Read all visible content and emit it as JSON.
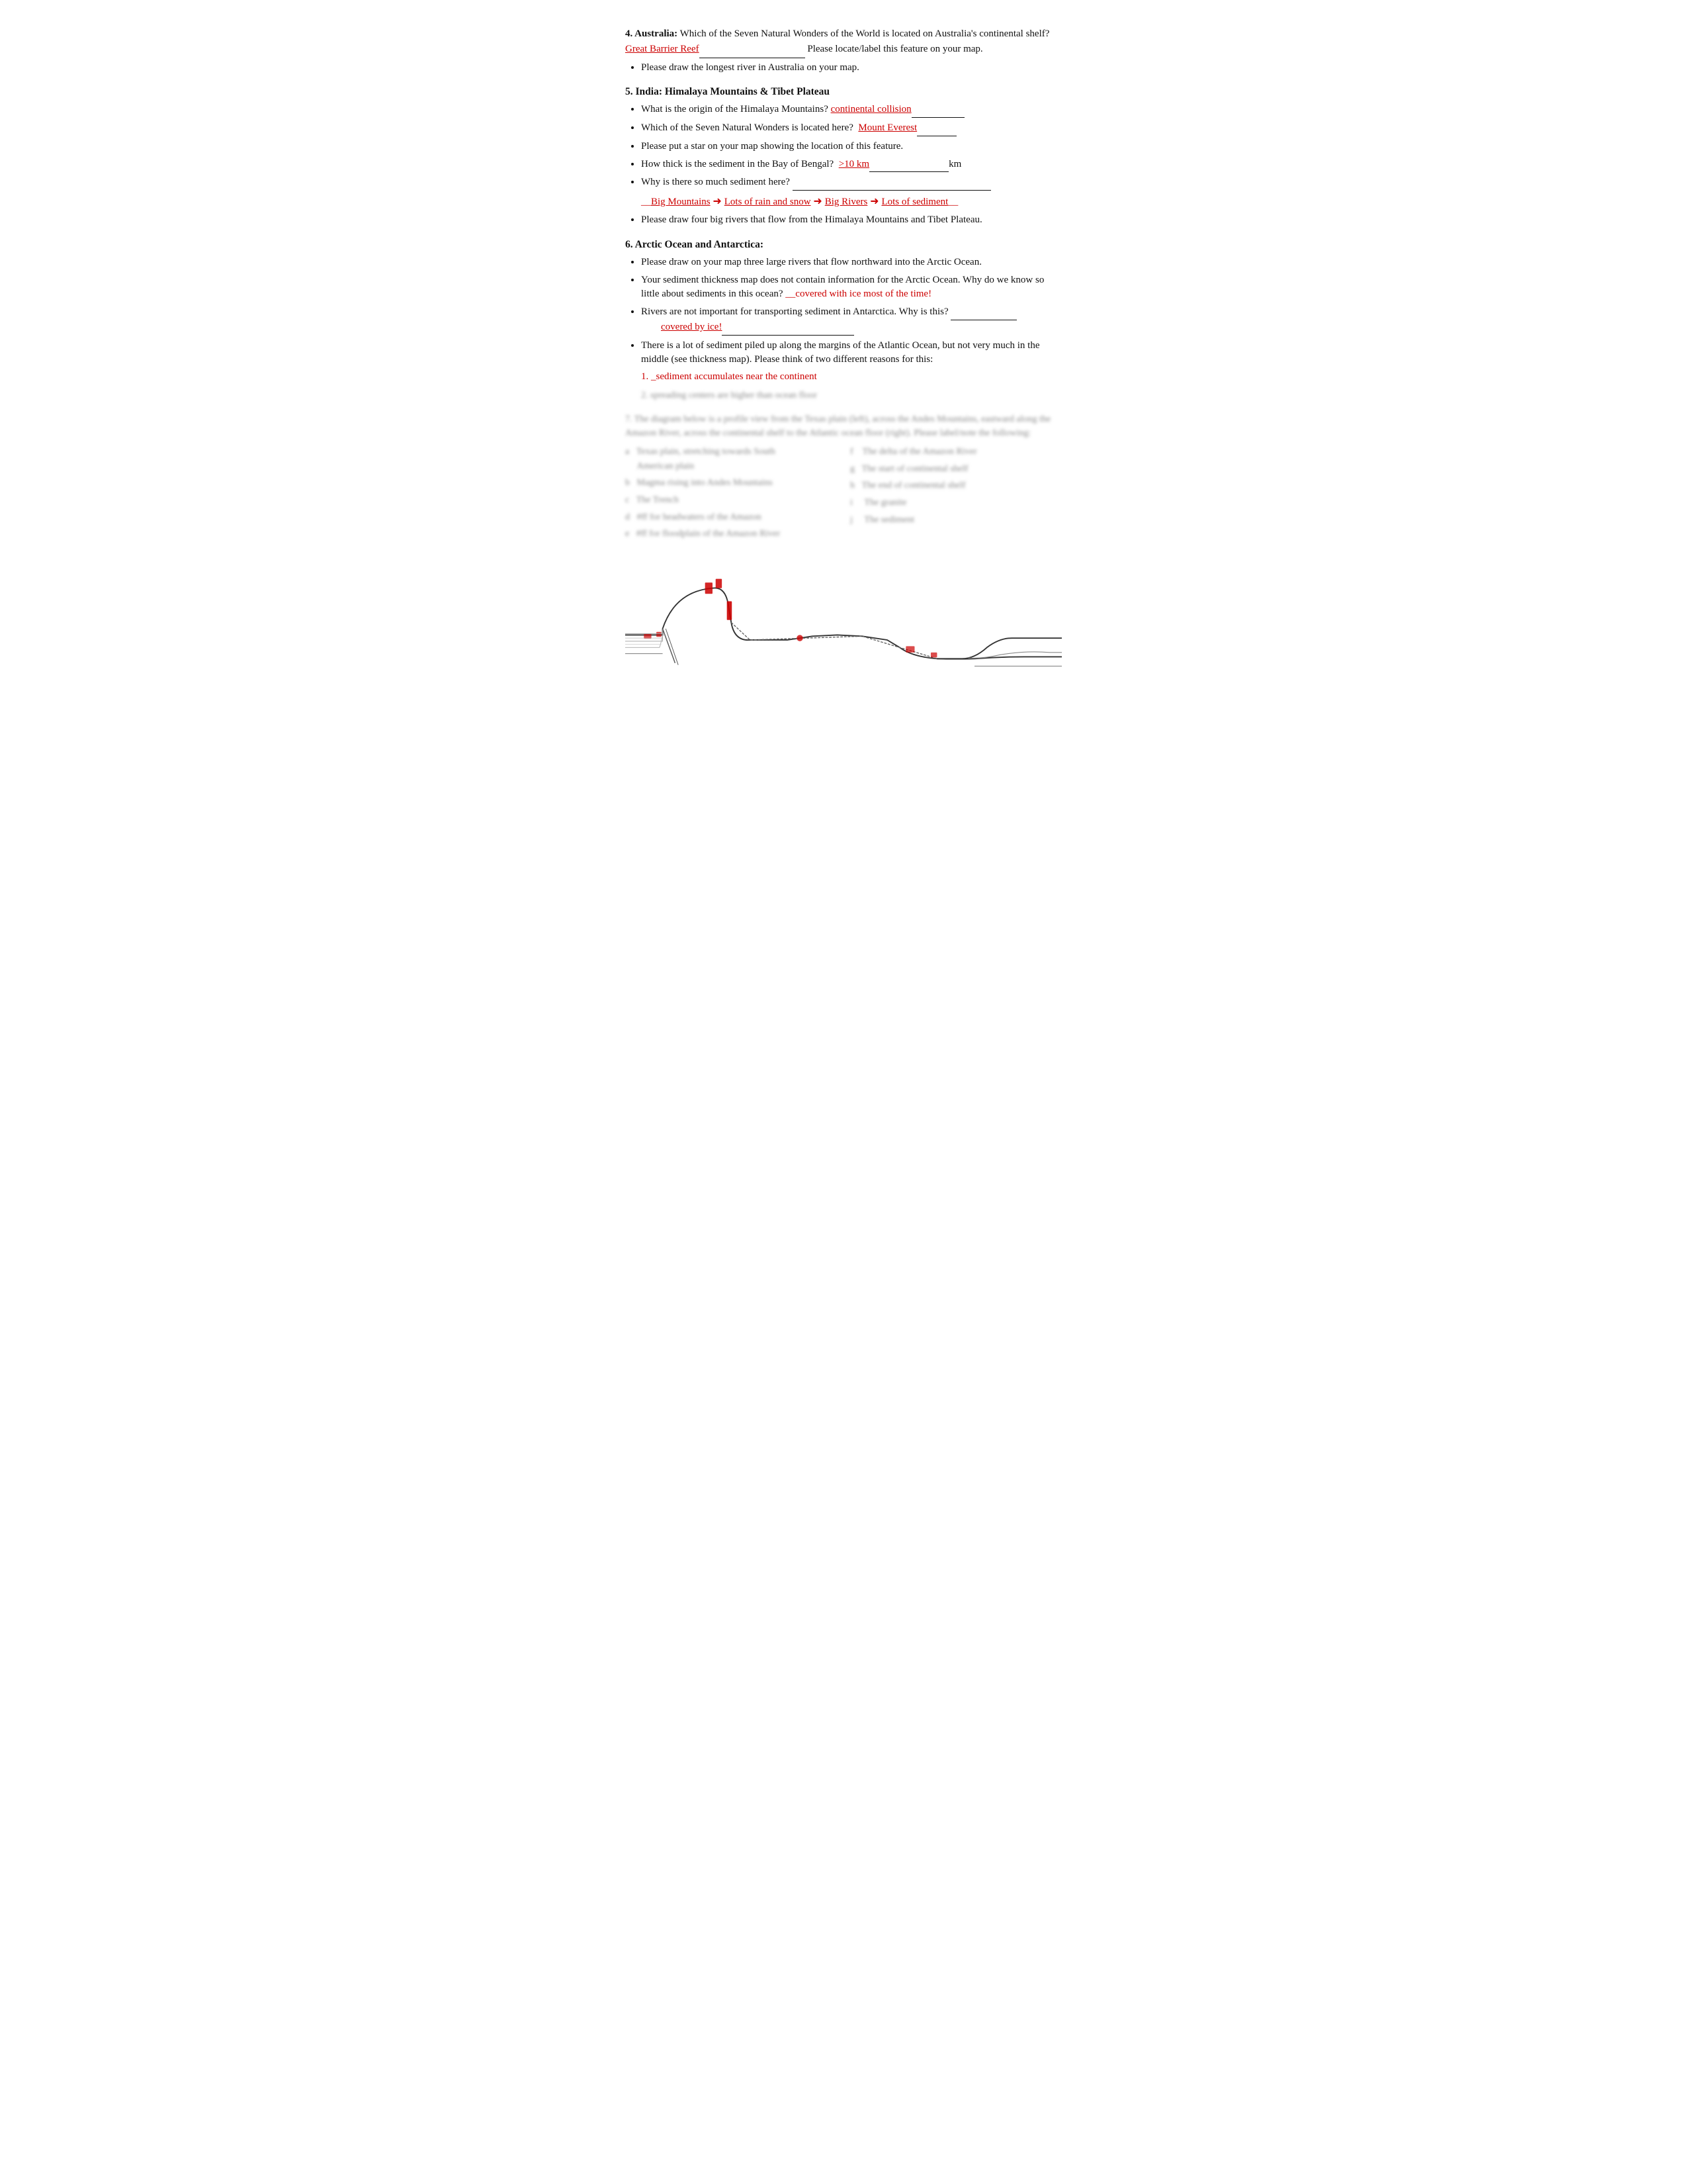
{
  "sections": {
    "s4": {
      "label": "4. Australia:",
      "question": " Which of the Seven Natural Wonders of the World is located on Australia's continental shelf?",
      "answer": "Great Barrier Reef",
      "after_answer": " Please locate/label this feature on your map.",
      "bullets": [
        "Please draw the longest river in Australia on your map."
      ]
    },
    "s5": {
      "label": "5. India:  Himalaya Mountains & Tibet Plateau",
      "bullets": [
        {
          "text": "What is the origin of the Himalaya Mountains? ",
          "answer": "continental collision",
          "blank_after": true,
          "blank_width": 80
        },
        {
          "text": "Which of the Seven Natural Wonders is located here?  ",
          "answer": "Mount Everest",
          "blank_after": true,
          "blank_width": 60
        },
        {
          "text": "Please put a star on your map showing the location of this feature.",
          "answer": "",
          "blank_after": false
        },
        {
          "text": "How thick is the sediment in the Bay of Bengal?  ",
          "answer": ">10 km",
          "blank_after": true,
          "blank_width": 140,
          "suffix": "km"
        },
        {
          "text": "Why is there so much sediment here?  ",
          "answer": "",
          "blank_after": false,
          "has_long_blank": true
        }
      ],
      "chain": {
        "parts": [
          "Big Mountains",
          "Lots of rain and snow",
          "Big Rivers",
          "Lots of sediment"
        ],
        "prefix": "__",
        "suffix": "__"
      },
      "last_bullet": "Please draw four big rivers that flow from the Himalaya Mountains and Tibet Plateau."
    },
    "s6": {
      "label": "6. Arctic Ocean and Antarctica:",
      "bullets": [
        {
          "text": "Please draw on your map three large rivers that flow northward into the Arctic Ocean.",
          "answer": ""
        },
        {
          "text": "Your sediment thickness map does not contain information for the Arctic Ocean.  Why do we know so little about sediments in this ocean?  ",
          "answer": "covered with ice most of the time!",
          "blank_prefix": "__"
        },
        {
          "text": "Rivers are not important for transporting sediment in Antarctica.  Why is this?  ",
          "answer": "covered by ice!",
          "blank_suffix_line": true
        },
        {
          "text": "There is a lot of sediment piled up along the margins of the Atlantic Ocean, but not very much in the middle (see thickness map).  Please think of two different reasons for this:",
          "answer": "",
          "sub_items": [
            {
              "num": "1.",
              "answer": "_sediment accumulates near the continent",
              "blurred": false
            },
            {
              "num": "2.",
              "answer": "spreading centers are higher than ocean floor",
              "blurred": true
            }
          ]
        }
      ]
    },
    "s7_blurred": {
      "lines": [
        "7. The diagram below is a profile view from the Texas plain (left), across the Andes Mountains, eastward along the Amazon River, across the continental shelf to the Atlantic ocean floor (right). Please label/note the following:",
        "a   Texas plain, stretching towards South    f   The delta of the Amazon River",
        "     American plain",
        "b   Magma rising into Andes Mountains       g  The start of continental shelf",
        "c   The Trench                                         h  The end of continental shelf",
        "d   #ff for headwaters of the Amazon           i    The granite",
        "e   #ff for floodplain of the Amazon River      j    The sediment"
      ]
    }
  },
  "colors": {
    "red": "#cc0000",
    "black": "#111111"
  },
  "diagram": {
    "description": "Profile view cross-section diagram with red annotations"
  }
}
